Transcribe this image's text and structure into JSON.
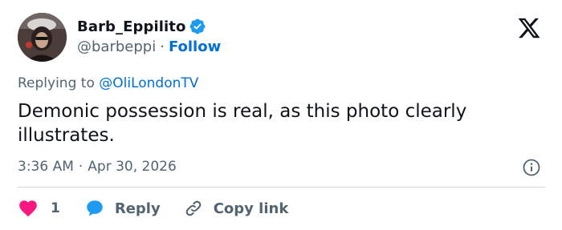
{
  "author": {
    "display_name": "Barb_Eppilito",
    "handle": "@barbeppi",
    "separator": "·",
    "follow_label": "Follow",
    "avatar_icon": "user-avatar",
    "verified_icon": "verified-badge-icon"
  },
  "brand": {
    "logo_icon": "x-logo-icon"
  },
  "reply_context": {
    "prefix": "Replying to ",
    "target": "@OliLondonTV"
  },
  "tweet": {
    "text": "Demonic possession is real, as this photo clearly illustrates.",
    "time": "3:36 AM",
    "separator": "·",
    "date": "Apr 30, 2026"
  },
  "actions": {
    "like_count": "1",
    "reply_label": "Reply",
    "copy_label": "Copy link"
  },
  "colors": {
    "accent": "#006fd6",
    "like": "#f91880",
    "reply_bubble": "#1d9bf0",
    "muted_text": "#536471",
    "text": "#0f1419",
    "divider": "#cfd9de"
  }
}
